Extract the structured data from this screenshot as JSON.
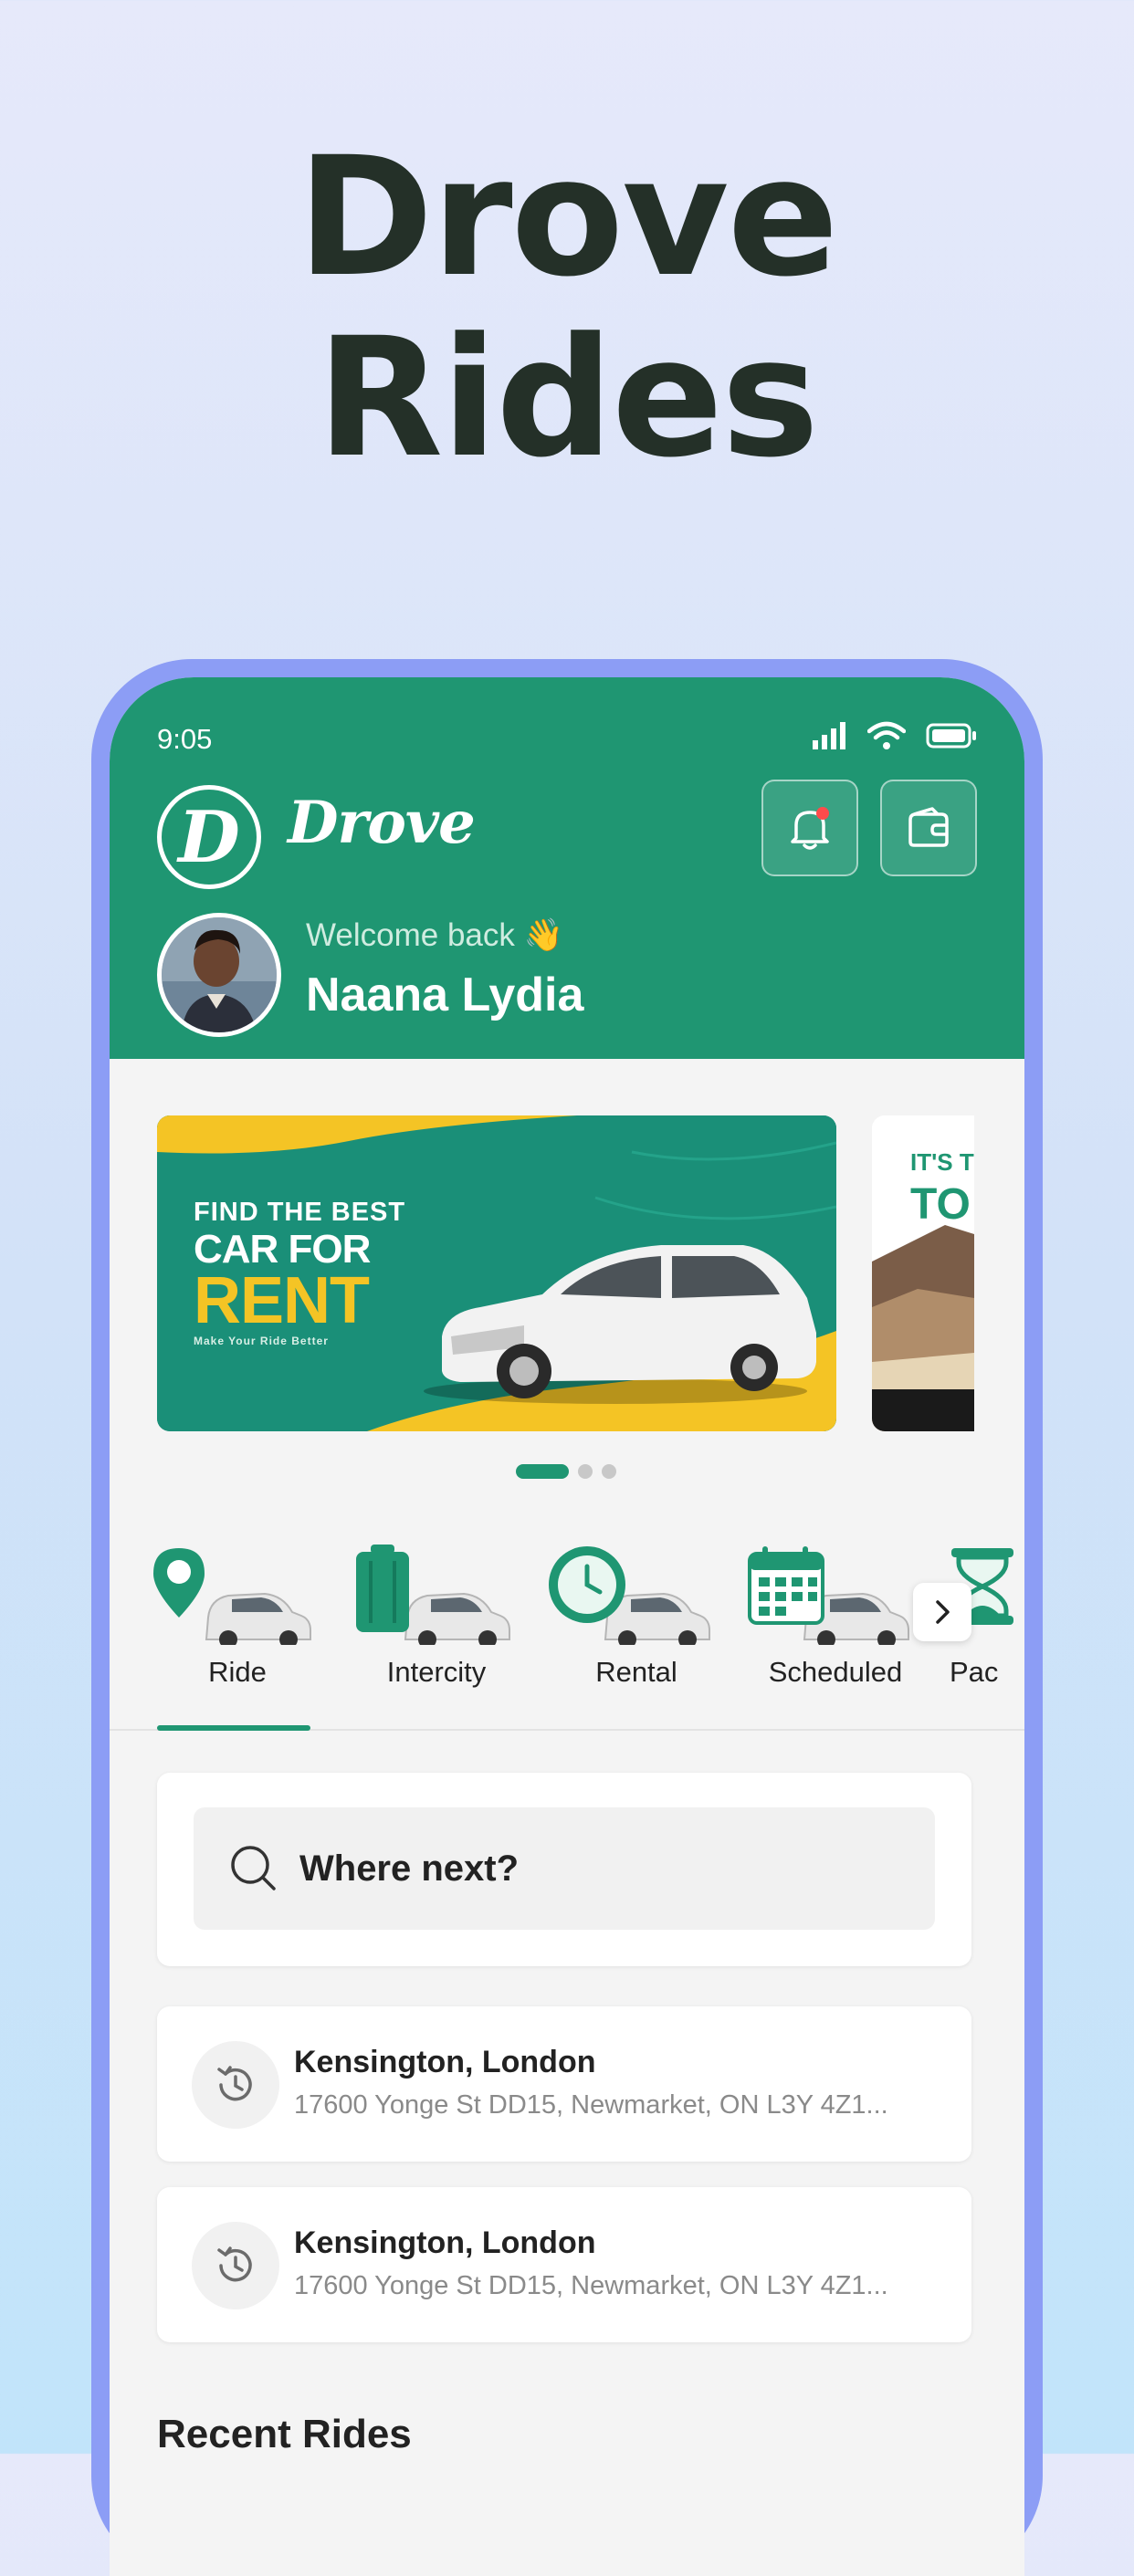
{
  "headline": {
    "line1": "Drove",
    "line2": "Rides"
  },
  "status_bar": {
    "time": "9:05"
  },
  "header": {
    "logo_letter": "D",
    "brand": "Drove",
    "welcome": "Welcome back 👋",
    "user_name": "Naana Lydia",
    "notification_dot_color": "#ff4b4b"
  },
  "banners": [
    {
      "line1": "FIND THE BEST",
      "line2": "CAR FOR",
      "line3": "RENT",
      "tagline": "Make Your Ride Better"
    },
    {
      "line1": "IT'S T",
      "line2": "TO"
    }
  ],
  "carousel": {
    "pages": 3,
    "active": 0
  },
  "categories": [
    {
      "label": "Ride",
      "icon": "map-pin-icon",
      "active": true
    },
    {
      "label": "Intercity",
      "icon": "luggage-icon",
      "active": false
    },
    {
      "label": "Rental",
      "icon": "clock-icon",
      "active": false
    },
    {
      "label": "Scheduled",
      "icon": "calendar-icon",
      "active": false
    },
    {
      "label": "Pac",
      "icon": "hourglass-icon",
      "active": false
    }
  ],
  "search": {
    "placeholder": "Where next?"
  },
  "recent_locations": [
    {
      "title": "Kensington, London",
      "address": "17600 Yonge St DD15, Newmarket, ON L3Y 4Z1..."
    },
    {
      "title": "Kensington, London",
      "address": "17600 Yonge St DD15, Newmarket, ON L3Y 4Z1..."
    }
  ],
  "sections": {
    "recent_rides": "Recent Rides"
  },
  "colors": {
    "brand_green": "#1f9672",
    "accent_yellow": "#f4c425",
    "frame": "#8c9df5"
  }
}
